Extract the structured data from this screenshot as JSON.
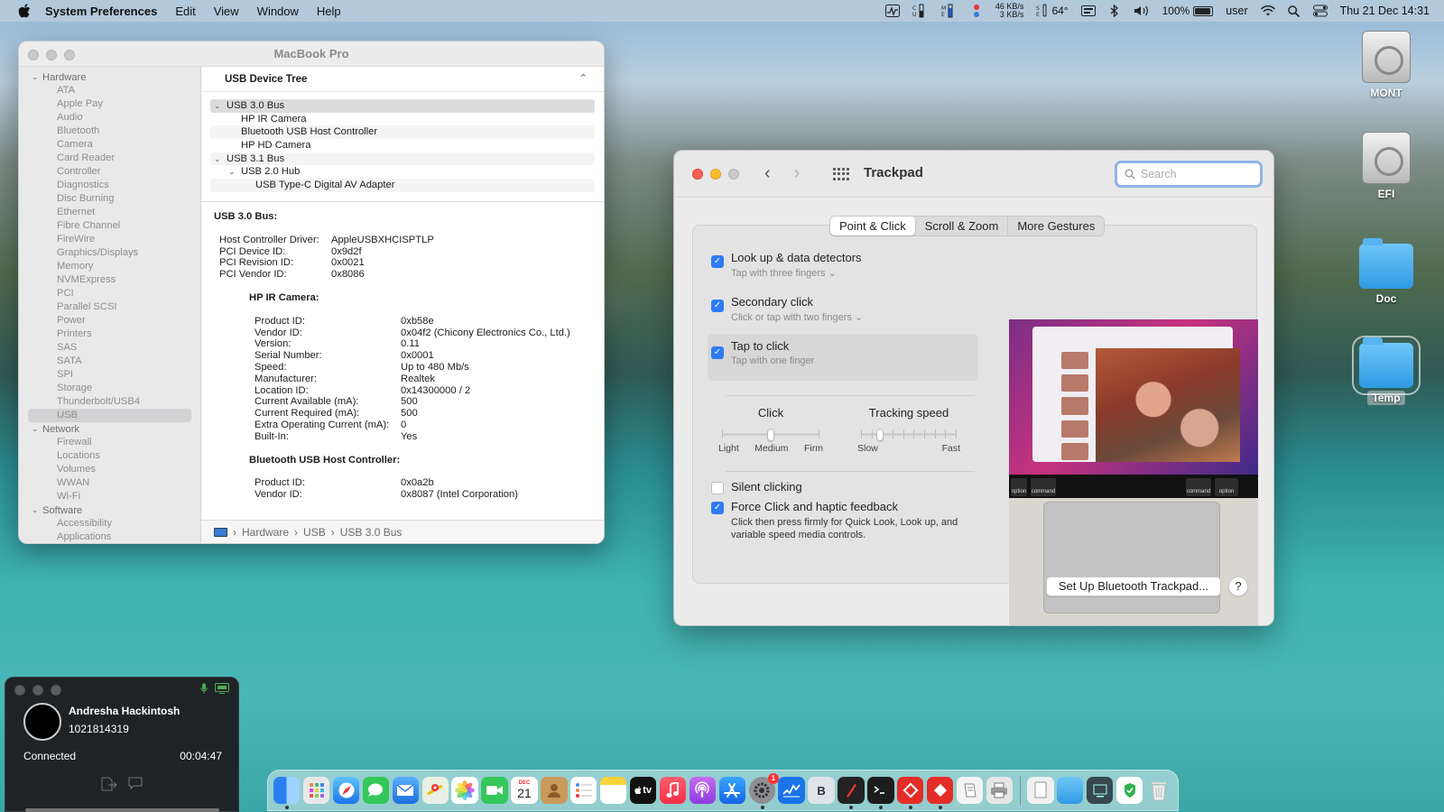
{
  "menubar": {
    "app_name": "System Preferences",
    "menus": [
      "Edit",
      "View",
      "Window",
      "Help"
    ],
    "net_up": "46 KB/s",
    "net_down": "3 KB/s",
    "temperature": "64°",
    "battery_percent": "100%",
    "user": "user",
    "datetime": "Thu 21 Dec  14:31"
  },
  "desktop": {
    "icons": [
      {
        "label": "MONT",
        "kind": "drive"
      },
      {
        "label": "EFI",
        "kind": "drive"
      },
      {
        "label": "Doc",
        "kind": "folder"
      },
      {
        "label": "Temp",
        "kind": "folder"
      }
    ]
  },
  "sysinfo": {
    "title": "MacBook Pro",
    "sidebar": {
      "hardware_label": "Hardware",
      "hardware_items": [
        "ATA",
        "Apple Pay",
        "Audio",
        "Bluetooth",
        "Camera",
        "Card Reader",
        "Controller",
        "Diagnostics",
        "Disc Burning",
        "Ethernet",
        "Fibre Channel",
        "FireWire",
        "Graphics/Displays",
        "Memory",
        "NVMExpress",
        "PCI",
        "Parallel SCSI",
        "Power",
        "Printers",
        "SAS",
        "SATA",
        "SPI",
        "Storage",
        "Thunderbolt/USB4",
        "USB"
      ],
      "selected": "USB",
      "network_label": "Network",
      "network_items": [
        "Firewall",
        "Locations",
        "Volumes",
        "WWAN",
        "Wi-Fi"
      ],
      "software_label": "Software",
      "software_items": [
        "Accessibility",
        "Applications"
      ]
    },
    "tree_header": "USB Device Tree",
    "tree": [
      {
        "label": "USB 3.0 Bus",
        "level": 0,
        "twisty": "down",
        "selected": true
      },
      {
        "label": "HP IR Camera",
        "level": 1
      },
      {
        "label": "Bluetooth USB Host Controller",
        "level": 1
      },
      {
        "label": "HP HD Camera",
        "level": 1
      },
      {
        "label": "USB 3.1 Bus",
        "level": 0,
        "twisty": "down"
      },
      {
        "label": "USB 2.0 Hub",
        "level": 1,
        "twisty": "down"
      },
      {
        "label": "USB Type-C Digital AV Adapter",
        "level": 2
      }
    ],
    "detail": {
      "heading": "USB 3.0 Bus:",
      "bus_props": [
        {
          "k": "Host Controller Driver:",
          "v": "AppleUSBXHCISPTLP"
        },
        {
          "k": "PCI Device ID:",
          "v": "0x9d2f"
        },
        {
          "k": "PCI Revision ID:",
          "v": "0x0021"
        },
        {
          "k": "PCI Vendor ID:",
          "v": "0x8086"
        }
      ],
      "camera_heading": "HP IR Camera:",
      "camera_props": [
        {
          "k": "Product ID:",
          "v": "0xb58e"
        },
        {
          "k": "Vendor ID:",
          "v": "0x04f2  (Chicony Electronics Co., Ltd.)"
        },
        {
          "k": "Version:",
          "v": "0.11"
        },
        {
          "k": "Serial Number:",
          "v": "0x0001"
        },
        {
          "k": "Speed:",
          "v": "Up to 480 Mb/s"
        },
        {
          "k": "Manufacturer:",
          "v": "Realtek"
        },
        {
          "k": "Location ID:",
          "v": "0x14300000 / 2"
        },
        {
          "k": "Current Available (mA):",
          "v": "500"
        },
        {
          "k": "Current Required (mA):",
          "v": "500"
        },
        {
          "k": "Extra Operating Current (mA):",
          "v": "0"
        },
        {
          "k": "Built-In:",
          "v": "Yes"
        }
      ],
      "bt_heading": "Bluetooth USB Host Controller:",
      "bt_props": [
        {
          "k": "Product ID:",
          "v": "0x0a2b"
        },
        {
          "k": "Vendor ID:",
          "v": "0x8087  (Intel Corporation)"
        }
      ]
    },
    "path": [
      "Hardware",
      "USB",
      "USB 3.0 Bus"
    ]
  },
  "trackpad": {
    "title": "Trackpad",
    "search_placeholder": "Search",
    "tabs": [
      "Point & Click",
      "Scroll & Zoom",
      "More Gestures"
    ],
    "active_tab": "Point & Click",
    "options": [
      {
        "title": "Look up & data detectors",
        "sub": "Tap with three fingers",
        "checked": true,
        "dropdown": true
      },
      {
        "title": "Secondary click",
        "sub": "Click or tap with two fingers",
        "checked": true,
        "dropdown": true
      },
      {
        "title": "Tap to click",
        "sub": "Tap with one finger",
        "checked": true,
        "highlighted": true
      }
    ],
    "click": {
      "label": "Click",
      "min": "Light",
      "mid": "Medium",
      "max": "Firm",
      "value": 0.5
    },
    "tracking": {
      "label": "Tracking speed",
      "min": "Slow",
      "max": "Fast",
      "value": 0.2
    },
    "silent_clicking": {
      "label": "Silent clicking",
      "checked": false
    },
    "force_click": {
      "label": "Force Click and haptic feedback",
      "checked": true,
      "desc": "Click then press firmly for Quick Look, Look up, and variable speed media controls."
    },
    "touchbar_keys": [
      "option",
      "command",
      "command",
      "option"
    ],
    "setup_button": "Set Up Bluetooth Trackpad...",
    "help_button": "?"
  },
  "remote": {
    "name": "Andresha Hackintosh",
    "id": "1021814319",
    "status": "Connected",
    "timer": "00:04:47"
  },
  "dock": {
    "calendar_month": "DEC",
    "calendar_day": "21",
    "appletv_label": "tv",
    "bbedit_label": "B",
    "badge_count": "1"
  },
  "colors": {
    "accent": "#2f7bf5",
    "close": "#fe5f57",
    "minimize": "#febc2e",
    "remote_green": "#4caf50"
  }
}
